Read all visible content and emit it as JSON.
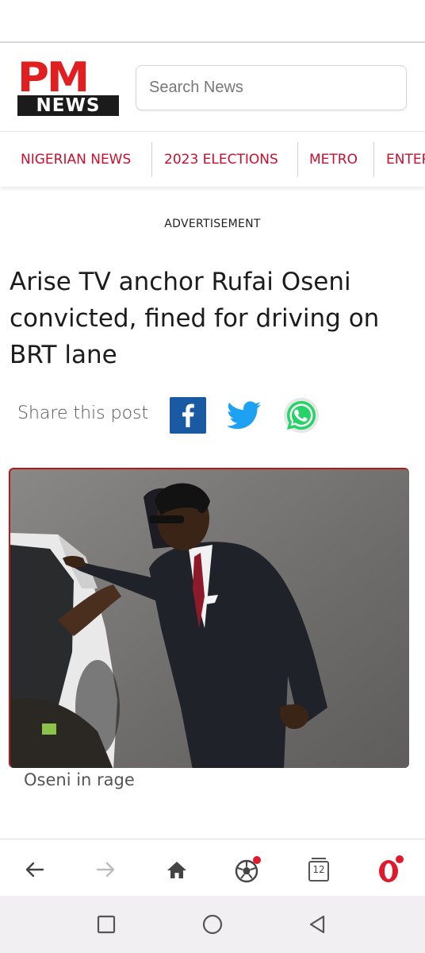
{
  "site": {
    "logo_top": "PM",
    "logo_bottom": "NEWS",
    "search_placeholder": "Search News"
  },
  "nav": {
    "items": [
      {
        "label": "NIGERIAN NEWS"
      },
      {
        "label": "2023 ELECTIONS"
      },
      {
        "label": "METRO"
      },
      {
        "label": "ENTERTAINMENT"
      }
    ]
  },
  "ad_label": "ADVERTISEMENT",
  "article": {
    "headline": "Arise TV anchor Rufai Oseni convicted, fined for driving on BRT lane",
    "share_label": "Share this post",
    "share_icons": [
      "facebook-icon",
      "twitter-icon",
      "whatsapp-icon"
    ],
    "caption": "Oseni in rage"
  },
  "browser_bar": {
    "tab_count": "12",
    "icons": [
      "back-arrow-icon",
      "forward-arrow-icon",
      "home-icon",
      "football-icon",
      "tabs-icon",
      "opera-icon"
    ]
  },
  "android_nav": {
    "icons": [
      "recents-square-icon",
      "home-circle-icon",
      "back-triangle-icon"
    ]
  },
  "colors": {
    "brand_red": "#e02020",
    "nav_red": "#c8102e",
    "facebook_blue": "#1a5aa3",
    "twitter_blue": "#1da1f2",
    "whatsapp_green": "#25d366"
  }
}
